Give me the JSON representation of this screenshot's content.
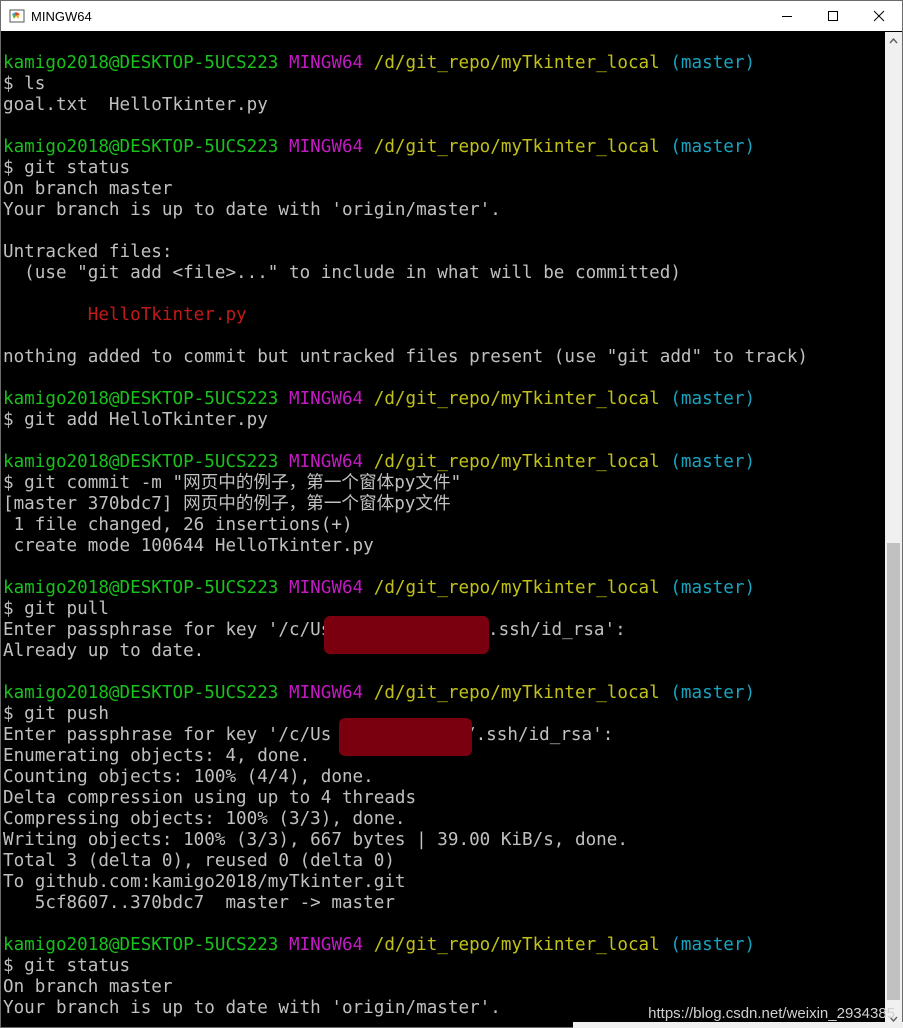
{
  "window": {
    "title": "MINGW64",
    "icon": "git-bash-icon"
  },
  "controls": {
    "minimize": "minimize-icon",
    "maximize": "maximize-icon",
    "close": "close-icon"
  },
  "prompt": {
    "user": "kamigo2018@DESKTOP-5UCS223",
    "shell": "MINGW64",
    "path": "/d/git_repo/myTkinter_local",
    "branch": "(master)"
  },
  "cmd": {
    "ls": "$ ls",
    "status": "$ git status",
    "add": "$ git add HelloTkinter.py",
    "commit": "$ git commit -m \"网页中的例子，第一个窗体py文件\"",
    "pull": "$ git pull",
    "push": "$ git push"
  },
  "out": {
    "ls": "goal.txt  HelloTkinter.py",
    "onbranch": "On branch master",
    "uptodate": "Your branch is up to date with 'origin/master'.",
    "untracked": "Untracked files:",
    "usehint": "  (use \"git add <file>...\" to include in what will be committed)",
    "untracked_file": "        HelloTkinter.py",
    "nothing": "nothing added to commit but untracked files present (use \"git add\" to track)",
    "commit1": "[master 370bdc7] 网页中的例子，第一个窗体py文件",
    "commit2": " 1 file changed, 26 insertions(+)",
    "commit3": " create mode 100644 HelloTkinter.py",
    "pass_pull_a": "Enter passphrase for key '/c/Us",
    "pass_pull_b": ".ssh/id_rsa':",
    "already": "Already up to date.",
    "pass_push_a": "Enter passphrase for key '/c/Us",
    "pass_push_b": "/.ssh/id_rsa':",
    "enum": "Enumerating objects: 4, done.",
    "count": "Counting objects: 100% (4/4), done.",
    "delta": "Delta compression using up to 4 threads",
    "compress": "Compressing objects: 100% (3/3), done.",
    "write": "Writing objects: 100% (3/3), 667 bytes | 39.00 KiB/s, done.",
    "total": "Total 3 (delta 0), reused 0 (delta 0)",
    "to": "To github.com:kamigo2018/myTkinter.git",
    "refs": "   5cf8607..370bdc7  master -> master"
  },
  "watermark": "https://blog.csdn.net/weixin_2934385",
  "colors": {
    "green": "#19c11d",
    "magenta": "#c31ac3",
    "yellow": "#c1c119",
    "cyan": "#17a4c1",
    "red": "#c11919",
    "text": "#c0c0c0"
  }
}
